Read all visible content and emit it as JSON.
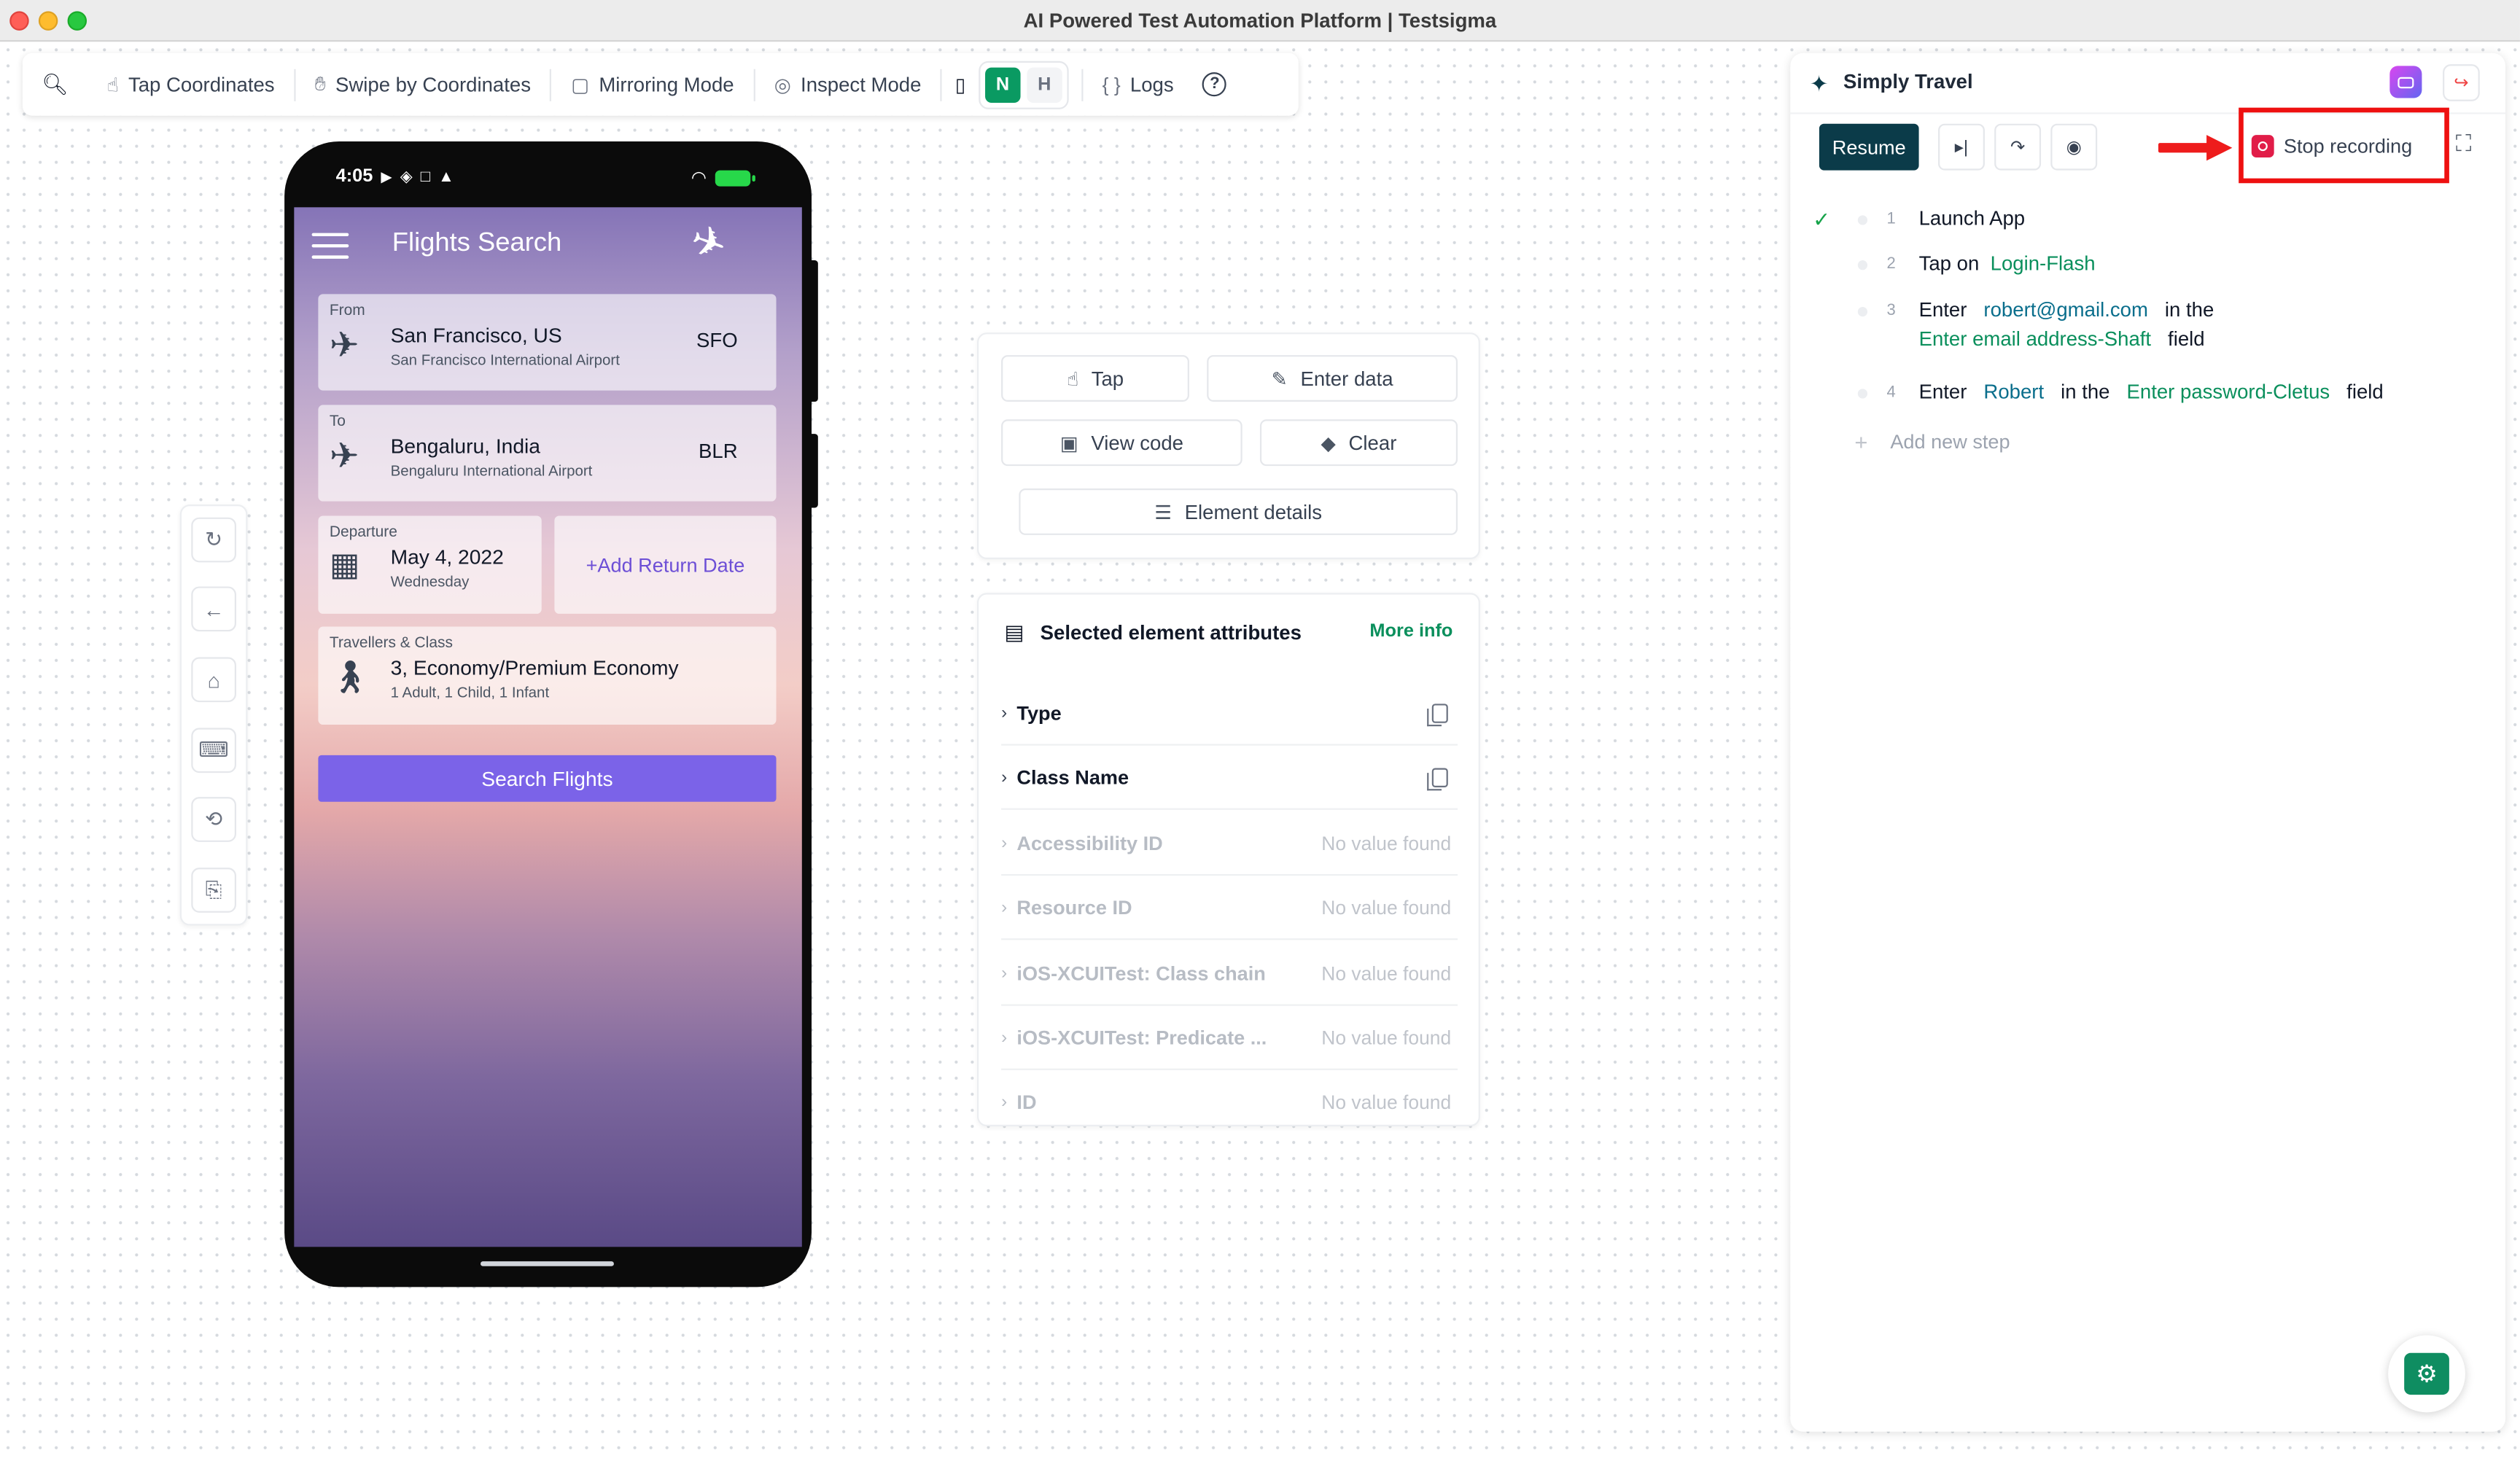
{
  "window": {
    "title": "AI Powered Test Automation Platform | Testsigma"
  },
  "toolbar": {
    "tap_coordinates": "Tap Coordinates",
    "swipe_coordinates": "Swipe by Coordinates",
    "mirroring_mode": "Mirroring Mode",
    "inspect_mode": "Inspect Mode",
    "n_label": "N",
    "h_label": "H",
    "logs": "Logs",
    "help": "?"
  },
  "device": {
    "time": "4:05",
    "app": {
      "title": "Flights Search",
      "from": {
        "label": "From",
        "city": "San Francisco, US",
        "airport": "San Francisco International Airport",
        "code": "SFO"
      },
      "to": {
        "label": "To",
        "city": "Bengaluru, India",
        "airport": "Bengaluru International Airport",
        "code": "BLR"
      },
      "departure": {
        "label": "Departure",
        "date": "May 4, 2022",
        "day": "Wednesday"
      },
      "return_label": "+Add Return Date",
      "travellers": {
        "label": "Travellers & Class",
        "summary": "3, Economy/Premium Economy",
        "detail": "1 Adult, 1 Child, 1 Infant"
      },
      "search_button": "Search Flights"
    }
  },
  "actions": {
    "tap": "Tap",
    "enter_data": "Enter data",
    "view_code": "View code",
    "clear": "Clear",
    "element_details": "Element details"
  },
  "attributes": {
    "title": "Selected element attributes",
    "more_info": "More info",
    "rows": [
      {
        "name": "Type",
        "value": ""
      },
      {
        "name": "Class Name",
        "value": ""
      },
      {
        "name": "Accessibility ID",
        "value": "No value found"
      },
      {
        "name": "Resource ID",
        "value": "No value found"
      },
      {
        "name": "iOS-XCUITest: Class chain",
        "value": "No value found"
      },
      {
        "name": "iOS-XCUITest: Predicate ...",
        "value": "No value found"
      },
      {
        "name": "ID",
        "value": "No value found"
      }
    ]
  },
  "recorder": {
    "app_name": "Simply Travel",
    "resume": "Resume",
    "stop_recording": "Stop recording",
    "steps": [
      {
        "num": "1",
        "action": "Launch App"
      },
      {
        "num": "2",
        "action": "Tap on",
        "target": "Login-Flash"
      },
      {
        "num": "3",
        "action": "Enter",
        "value": "robert@gmail.com",
        "mid": "in the",
        "target": "Enter email address-Shaft",
        "suffix": "field"
      },
      {
        "num": "4",
        "action": "Enter",
        "value": "Robert",
        "mid": "in the",
        "target": "Enter password-Cletus",
        "suffix": "field"
      }
    ],
    "add_step": "Add new step"
  },
  "colors": {
    "accent": "#0a8f5c",
    "dark": "#0b3b49",
    "annotation": "#ee1c1c",
    "app_primary": "#7b63e8"
  }
}
